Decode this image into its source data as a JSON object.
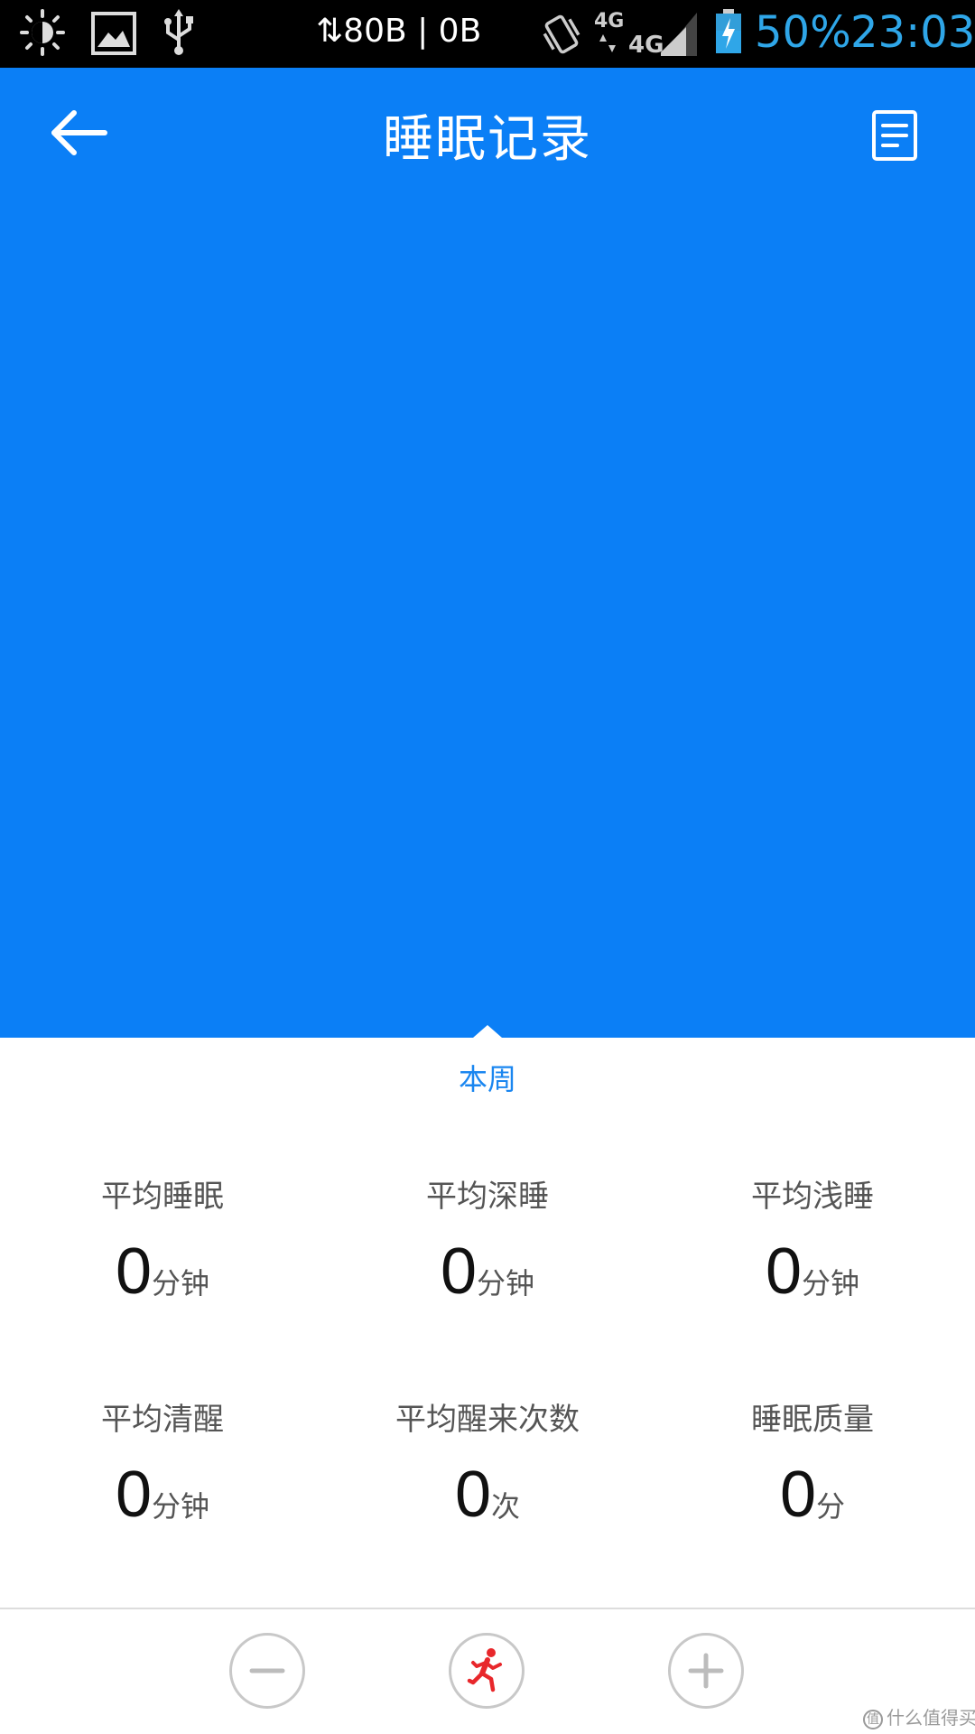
{
  "status_bar": {
    "network_speed": "⇅80B | 0B",
    "network_type": "4G",
    "battery_percent": "50%",
    "time": "23:03"
  },
  "header": {
    "title": "睡眠记录",
    "background_color": "#0b7ff6"
  },
  "period": {
    "label": "本周"
  },
  "stats": [
    {
      "label": "平均睡眠",
      "value": "0",
      "unit": "分钟"
    },
    {
      "label": "平均深睡",
      "value": "0",
      "unit": "分钟"
    },
    {
      "label": "平均浅睡",
      "value": "0",
      "unit": "分钟"
    },
    {
      "label": "平均清醒",
      "value": "0",
      "unit": "分钟"
    },
    {
      "label": "平均醒来次数",
      "value": "0",
      "unit": "次"
    },
    {
      "label": "睡眠质量",
      "value": "0",
      "unit": "分"
    }
  ],
  "bottom_bar": {
    "buttons": [
      {
        "icon": "minus-icon"
      },
      {
        "icon": "running-person-icon"
      },
      {
        "icon": "plus-icon"
      }
    ]
  },
  "watermark": {
    "text": "什么值得买",
    "logo": "值"
  }
}
